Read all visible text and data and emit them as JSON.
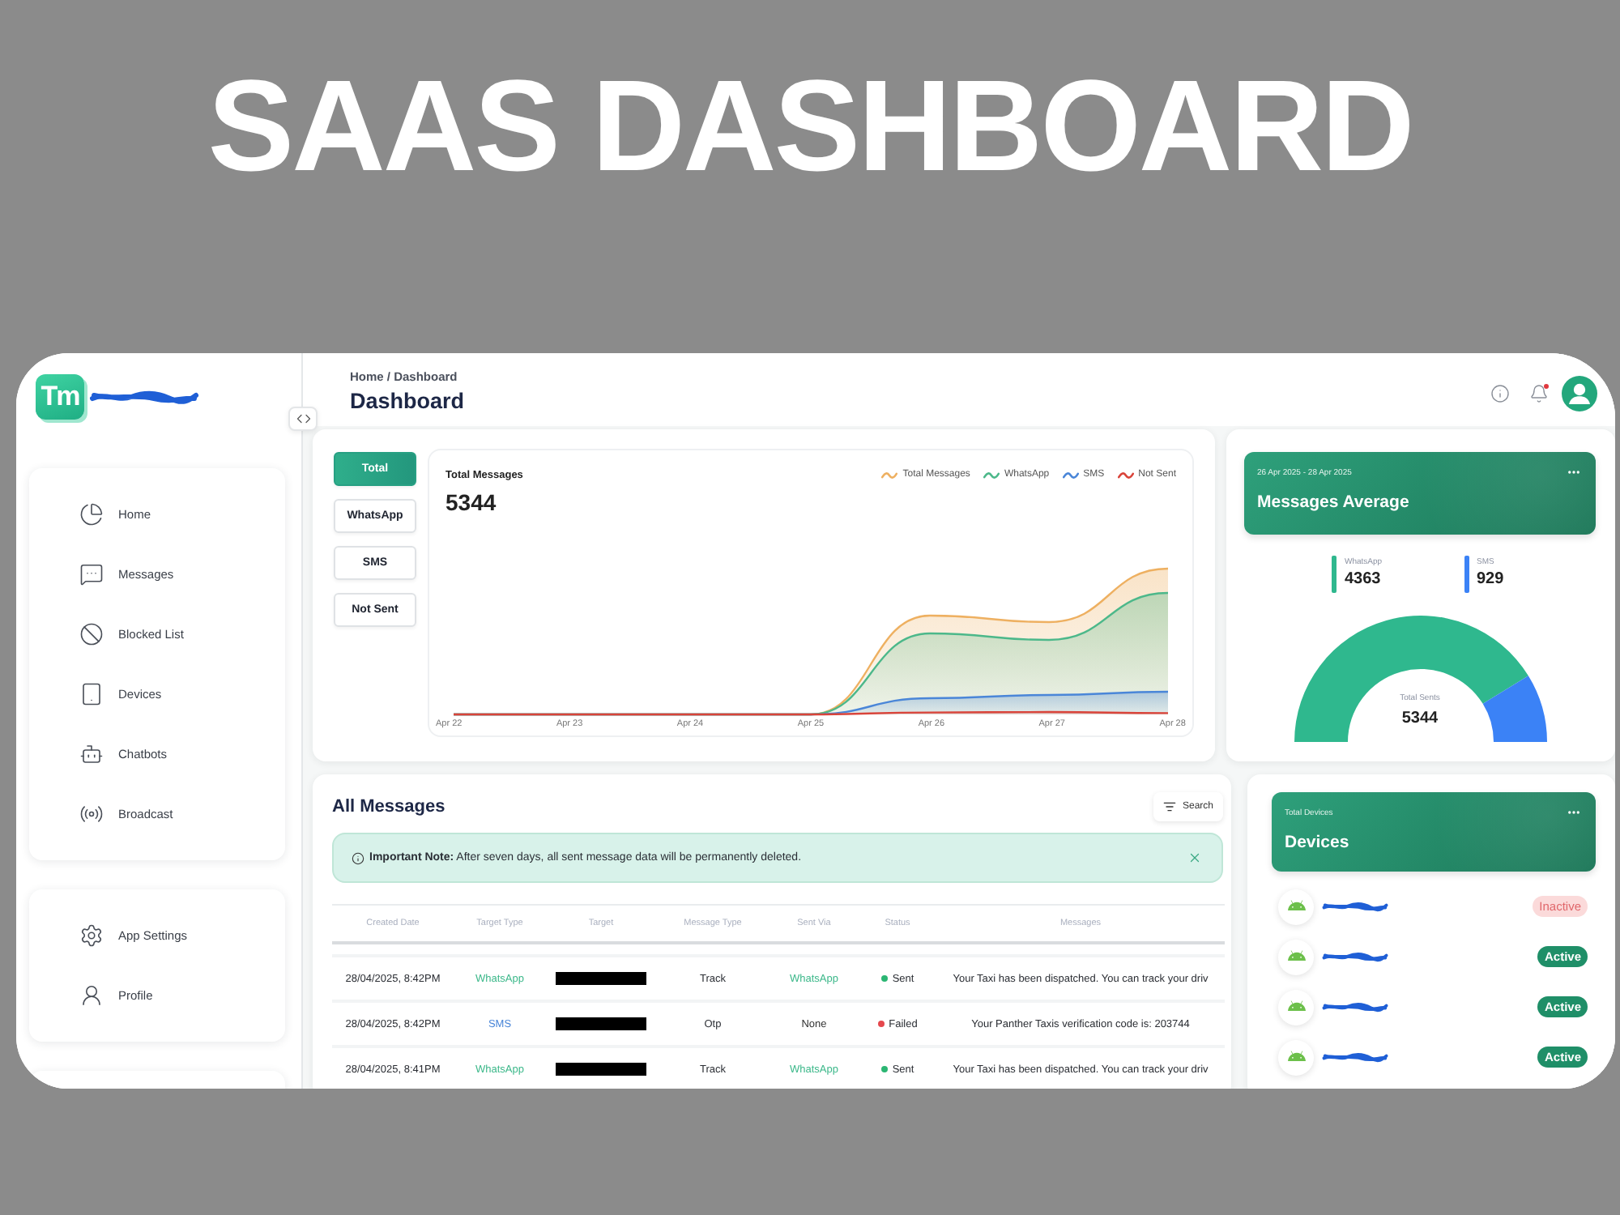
{
  "banner": {
    "title": "SAAS DASHBOARD"
  },
  "sidebar": {
    "logo": "Tm",
    "sections": [
      {
        "items": [
          {
            "label": "Home"
          },
          {
            "label": "Messages"
          },
          {
            "label": "Blocked List"
          },
          {
            "label": "Devices"
          },
          {
            "label": "Chatbots"
          },
          {
            "label": "Broadcast"
          }
        ]
      },
      {
        "items": [
          {
            "label": "App Settings"
          },
          {
            "label": "Profile"
          }
        ]
      }
    ]
  },
  "header": {
    "breadcrumb": "Home / Dashboard",
    "title": "Dashboard",
    "unread": true
  },
  "chart": {
    "filters": [
      {
        "label": "Total",
        "selected": true
      },
      {
        "label": "WhatsApp",
        "selected": false
      },
      {
        "label": "SMS",
        "selected": false
      },
      {
        "label": "Not Sent",
        "selected": false
      }
    ],
    "title": "Total Messages",
    "total": "5344",
    "legend": [
      {
        "label": "Total Messages",
        "color": "#eeb061"
      },
      {
        "label": "WhatsApp",
        "color": "#4cb88a"
      },
      {
        "label": "SMS",
        "color": "#4a86d8"
      },
      {
        "label": "Not Sent",
        "color": "#d9443a"
      }
    ],
    "x_labels": [
      "Apr 22",
      "Apr 23",
      "Apr 24",
      "Apr 25",
      "Apr 26",
      "Apr 27",
      "Apr 28"
    ]
  },
  "messages_average": {
    "date_range": "26 Apr 2025 - 28 Apr 2025",
    "title": "Messages Average",
    "stats": [
      {
        "label": "WhatsApp",
        "value": "4363",
        "color": "#2fb88e"
      },
      {
        "label": "SMS",
        "value": "929",
        "color": "#3b82f6"
      }
    ],
    "total_label": "Total Sents",
    "total": "5344"
  },
  "messages": {
    "title": "All Messages",
    "search": "Search",
    "note": "**Important Note:** After seven days, all sent message data will be permanently deleted.",
    "columns": [
      "Created Date",
      "Target Type",
      "Target",
      "Message Type",
      "Sent Via",
      "Status",
      "Messages"
    ],
    "rows": [
      {
        "created": "28/04/2025, 8:42PM",
        "target_type": {
          "text": "WhatsApp",
          "color": "#3cb88a"
        },
        "message_type": "Track",
        "sent_via": {
          "text": "WhatsApp",
          "color": "#3cb88a"
        },
        "status": {
          "text": "Sent",
          "color": "#2bb673"
        },
        "message": "Your Taxi has been dispatched. You can track your driv"
      },
      {
        "created": "28/04/2025, 8:42PM",
        "target_type": {
          "text": "SMS",
          "color": "#4a86d8"
        },
        "message_type": "Otp",
        "sent_via": {
          "text": "None",
          "color": "#333333"
        },
        "status": {
          "text": "Failed",
          "color": "#e5484d"
        },
        "message": "Your Panther Taxis verification code is: 203744"
      },
      {
        "created": "28/04/2025, 8:41PM",
        "target_type": {
          "text": "WhatsApp",
          "color": "#3cb88a"
        },
        "message_type": "Track",
        "sent_via": {
          "text": "WhatsApp",
          "color": "#3cb88a"
        },
        "status": {
          "text": "Sent",
          "color": "#2bb673"
        },
        "message": "Your Taxi has been dispatched. You can track your driv"
      }
    ]
  },
  "devices": {
    "caption": "Total Devices",
    "title": "Devices",
    "items": [
      {
        "status": "Inactive",
        "active": false
      },
      {
        "status": "Active",
        "active": true
      },
      {
        "status": "Active",
        "active": true
      },
      {
        "status": "Active",
        "active": true
      }
    ]
  }
}
